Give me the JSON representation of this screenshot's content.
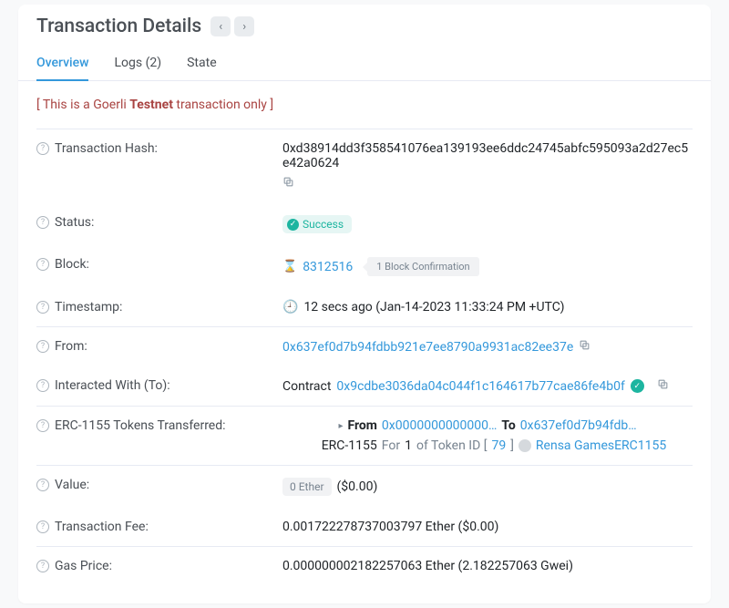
{
  "header": {
    "title": "Transaction Details"
  },
  "tabs": {
    "overview": "Overview",
    "logs": "Logs (2)",
    "state": "State"
  },
  "notice": {
    "prefix": "[ This is a Goerli ",
    "bold": "Testnet",
    "suffix": " transaction only ]"
  },
  "labels": {
    "tx_hash": "Transaction Hash:",
    "status": "Status:",
    "block": "Block:",
    "timestamp": "Timestamp:",
    "from": "From:",
    "to": "Interacted With (To):",
    "erc1155": "ERC-1155 Tokens Transferred:",
    "value": "Value:",
    "fee": "Transaction Fee:",
    "gas": "Gas Price:"
  },
  "values": {
    "tx_hash": "0xd38914dd3f358541076ea139193ee6ddc24745abfc595093a2d27ec5e42a0624",
    "status": "Success",
    "block_number": "8312516",
    "confirmations": "1 Block Confirmation",
    "timestamp": "12 secs ago (Jan-14-2023 11:33:24 PM +UTC)",
    "from_addr": "0x637ef0d7b94fdbb921e7ee8790a9931ac82ee37e",
    "to_prefix": "Contract",
    "to_addr": "0x9cdbe3036da04c044f1c164617b77cae86fe4b0f",
    "transfer": {
      "from_label": "From",
      "from_addr": "0x0000000000000…",
      "to_label": "To",
      "to_addr": "0x637ef0d7b94fdb…",
      "line2_prefix": "ERC-1155",
      "line2_for": "For",
      "line2_amount": "1",
      "line2_of": "of Token ID [",
      "token_id": "79",
      "line2_close": "]",
      "token_name": "Rensa GamesERC1155"
    },
    "value_eth": "0 Ether",
    "value_usd": "($0.00)",
    "fee": "0.001722278737003797 Ether ($0.00)",
    "gas": "0.000000002182257063 Ether (2.182257063 Gwei)"
  }
}
